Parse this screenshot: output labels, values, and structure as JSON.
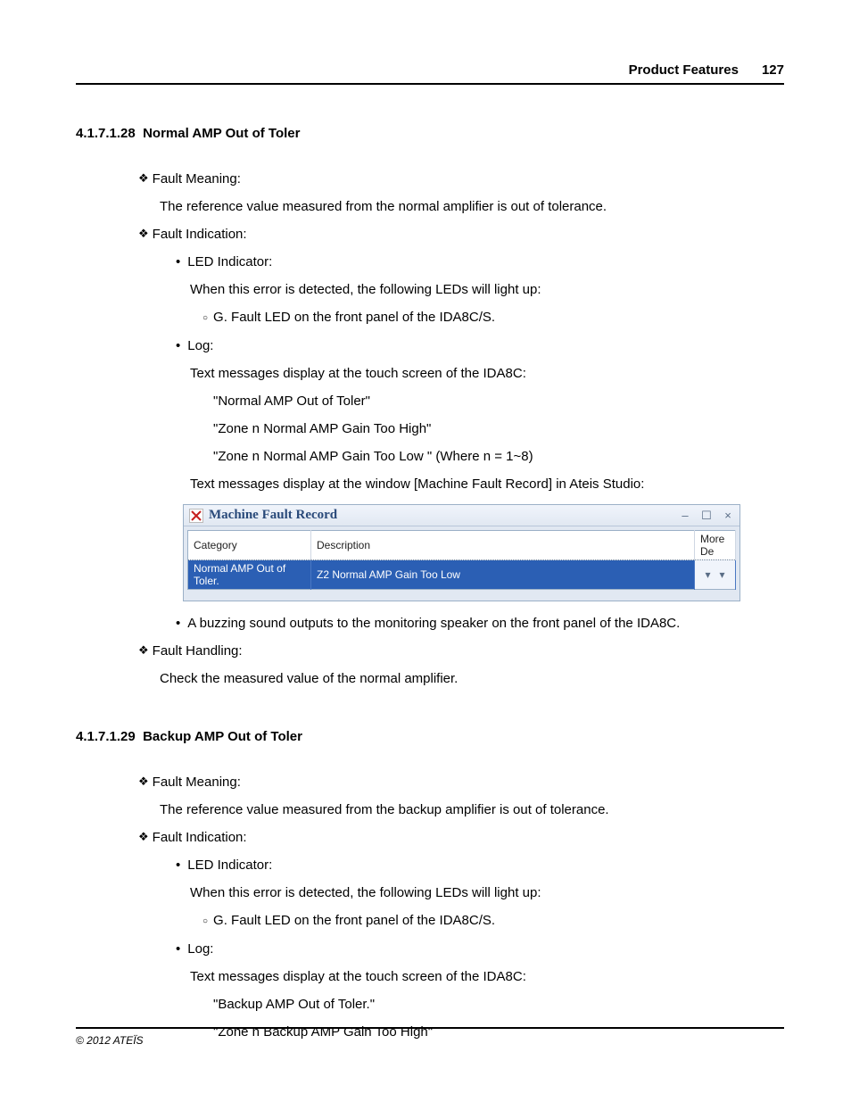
{
  "header": {
    "title": "Product Features",
    "page_number": "127"
  },
  "section28": {
    "number": "4.1.7.1.28",
    "title": "Normal AMP Out of Toler",
    "fault_meaning_label": "Fault Meaning:",
    "fault_meaning_text": "The reference value measured from the normal amplifier is out of tolerance.",
    "fault_indication_label": "Fault Indication:",
    "led_indicator_label": "LED Indicator:",
    "led_text": "When this error is detected, the following LEDs will light up:",
    "led_sub1": "G. Fault LED on the front panel of the IDA8C/S.",
    "log_label": "Log:",
    "log_touch_intro": "Text messages display at the touch screen of the IDA8C:",
    "log_msg1": "\"Normal AMP Out of Toler\"",
    "log_msg2": "\"Zone n Normal AMP Gain Too High\"",
    "log_msg3": "\"Zone n Normal AMP Gain Too Low \" (Where n = 1~8)",
    "log_window_intro": "Text messages display at the window [Machine Fault Record] in Ateis Studio:",
    "buzzing_text": "A buzzing sound outputs to the monitoring speaker on the front panel of the IDA8C.",
    "fault_handling_label": "Fault Handling:",
    "fault_handling_text": "Check the measured value of the normal amplifier."
  },
  "mfr_window": {
    "title": "Machine Fault Record",
    "col_category": "Category",
    "col_description": "Description",
    "col_more": "More De",
    "row_category": "Normal AMP Out of Toler.",
    "row_description": "Z2 Normal AMP Gain Too Low",
    "btn_min": "–",
    "btn_max": "☐",
    "btn_close": "×",
    "dropdown": "▾"
  },
  "section29": {
    "number": "4.1.7.1.29",
    "title": "Backup AMP Out of Toler",
    "fault_meaning_label": "Fault Meaning:",
    "fault_meaning_text": "The reference value measured from the backup amplifier is out of tolerance.",
    "fault_indication_label": "Fault Indication:",
    "led_indicator_label": "LED Indicator:",
    "led_text": "When this error is detected, the following LEDs will light up:",
    "led_sub1": "G. Fault LED on the front panel of the IDA8C/S.",
    "log_label": "Log:",
    "log_touch_intro": "Text messages display at the touch screen of the IDA8C:",
    "log_msg1": "\"Backup AMP Out of Toler.\"",
    "log_msg2": "\"Zone n Backup AMP Gain Too High\""
  },
  "footer": {
    "copyright": "© 2012 ATEÏS"
  }
}
